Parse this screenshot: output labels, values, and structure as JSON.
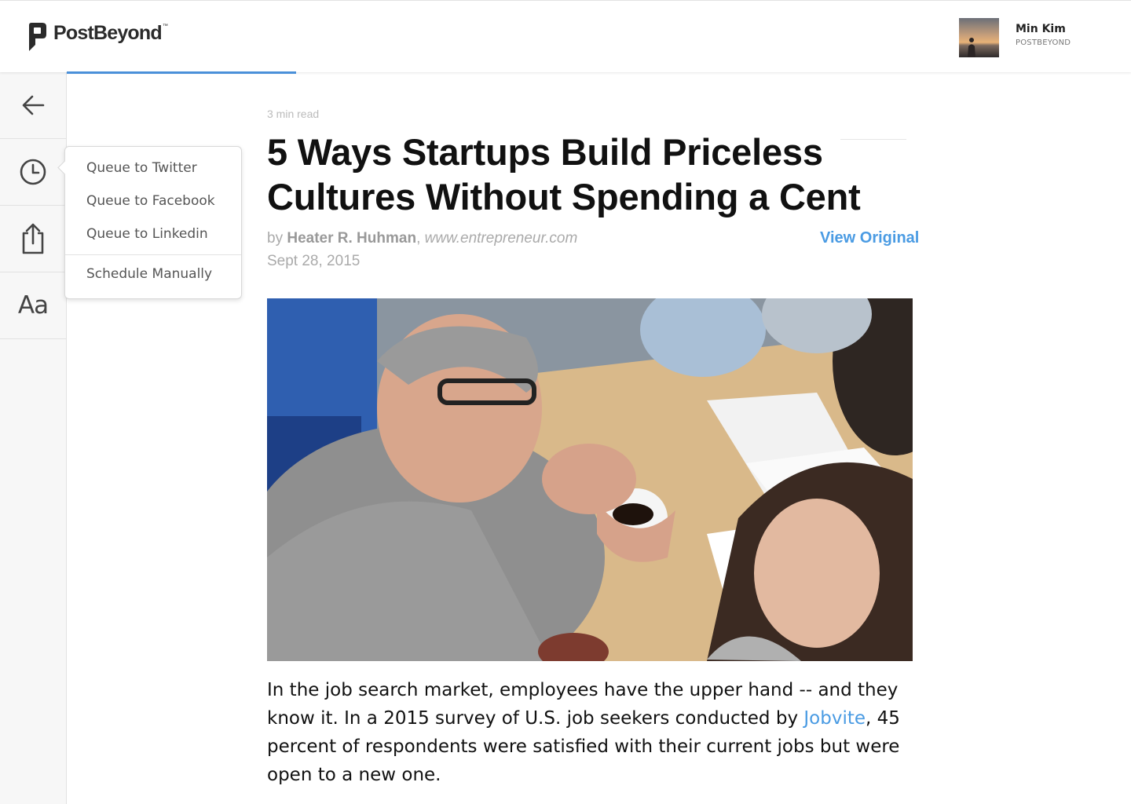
{
  "header": {
    "logo_text": "PostBeyond",
    "logo_tm": "™",
    "user": {
      "name": "Min Kim",
      "org": "POSTBEYOND"
    }
  },
  "sidebar": {
    "items": [
      {
        "icon": "back-arrow-icon"
      },
      {
        "icon": "clock-icon"
      },
      {
        "icon": "share-icon"
      },
      {
        "icon": "text-size-icon",
        "label": "Aa"
      }
    ]
  },
  "dropdown": {
    "items": [
      "Queue to Twitter",
      "Queue to Facebook",
      "Queue to Linkedin"
    ],
    "schedule": "Schedule Manually"
  },
  "article": {
    "read_time": "3 min read",
    "title": "5 Ways Startups Build Priceless Cultures Without Spending a Cent",
    "by": "by ",
    "author": "Heater R. Huhman",
    "comma": ", ",
    "source": "www.entrepreneur.com",
    "date": "Sept 28, 2015",
    "view_original": "View Original",
    "body_before": "In the job search market, employees have the upper hand -- and they know it. In a 2015 survey of U.S. job seekers conducted by ",
    "body_link": "Jobvite",
    "body_after": ", 45 percent of respondents were satisfied with their current jobs but were open to a new one."
  },
  "colors": {
    "accent": "#4a9be3",
    "progress": "#4a90d9"
  }
}
